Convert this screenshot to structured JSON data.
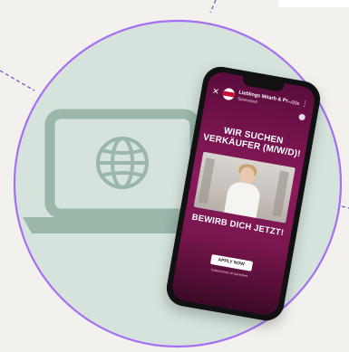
{
  "ad": {
    "close_glyph": "✕",
    "brand_name": "Lieblings Mitarb & Pr...",
    "sponsored": "Sponsored",
    "timer": "00s",
    "more_glyph": "⋮",
    "headline_line1": "WIR SUCHEN",
    "headline_line2": "VERKÄUFER (M/W/D)!",
    "cta_text": "BEWIRB DICH JETZT!",
    "apply_label": "APPLY NOW",
    "disclaimer": "Datenschutz ist garantiert"
  },
  "colors": {
    "circle_fill": "#d5e3dc",
    "circle_ring": "#a66ff0",
    "laptop": "#9ab7aa",
    "ad_magenta": "#a3246a"
  },
  "icons": {
    "laptop": "laptop-icon",
    "globe": "globe-icon"
  }
}
